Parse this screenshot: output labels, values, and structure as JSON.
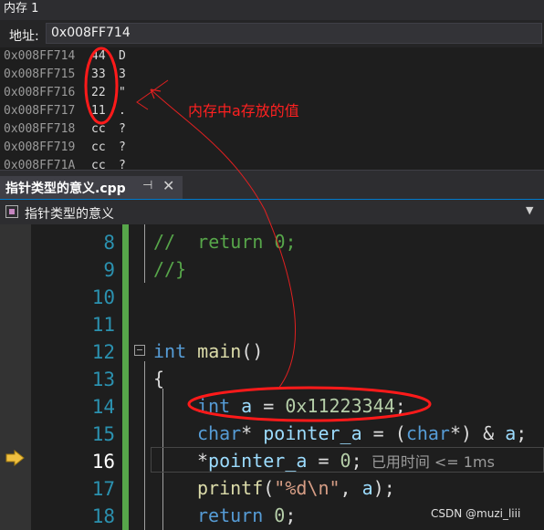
{
  "memory_window": {
    "title": "内存 1",
    "address_label": "地址:",
    "address_value": "0x008FF714",
    "rows": [
      {
        "addr": "0x008FF714",
        "val": "44",
        "chr": "D"
      },
      {
        "addr": "0x008FF715",
        "val": "33",
        "chr": "3"
      },
      {
        "addr": "0x008FF716",
        "val": "22",
        "chr": "\""
      },
      {
        "addr": "0x008FF717",
        "val": "11",
        "chr": "."
      },
      {
        "addr": "0x008FF718",
        "val": "cc",
        "chr": "?"
      },
      {
        "addr": "0x008FF719",
        "val": "cc",
        "chr": "?"
      },
      {
        "addr": "0x008FF71A",
        "val": "cc",
        "chr": "?"
      }
    ]
  },
  "annotation": {
    "text": "内存中a存放的值",
    "color": "#ff2020"
  },
  "editor": {
    "tab_label": "指针类型的意义.cpp",
    "nav_label": "指针类型的意义",
    "line_numbers": [
      "8",
      "9",
      "10",
      "11",
      "12",
      "13",
      "14",
      "15",
      "16",
      "17",
      "18"
    ],
    "current_line": "16",
    "lines": {
      "l8_comment": "//  return 0;",
      "l9_comment": "//}",
      "l12_kw": "int",
      "l12_fn": " main",
      "l12_rest": "()",
      "l13": "{",
      "l14_kw": "int",
      "l14_var": " a",
      "l14_eq": " = ",
      "l14_num": "0x11223344",
      "l14_end": ";",
      "l15_kw1": "char",
      "l15_mid1": "* ",
      "l15_var1": "pointer_a",
      "l15_mid2": " = (",
      "l15_kw2": "char",
      "l15_mid3": "*) & ",
      "l15_var2": "a",
      "l15_end": ";",
      "l16_star": "*",
      "l16_var": "pointer_a",
      "l16_eq": " = ",
      "l16_num": "0",
      "l16_end": ";",
      "l16_elapsed": "  已用时间 <= 1ms",
      "l17_fn": "printf",
      "l17_open": "(",
      "l17_str": "\"%d\\n\"",
      "l17_mid": ", ",
      "l17_var": "a",
      "l17_end": ");",
      "l18_kw": "return",
      "l18_sp": " ",
      "l18_num": "0",
      "l18_end": ";"
    }
  },
  "watermark": "CSDN @muzi_liii",
  "colors": {
    "background": "#1e1e1e",
    "line_number": "#2b91af",
    "keyword": "#569cd6",
    "comment": "#57a64a",
    "string": "#d69d85",
    "variable": "#9cdcfe",
    "function": "#dcdcaa",
    "number": "#b5cea8",
    "accent": "#007acc"
  },
  "icons": {
    "pin": "pin-icon",
    "close": "close-icon",
    "current_statement": "arrow-right-icon"
  }
}
